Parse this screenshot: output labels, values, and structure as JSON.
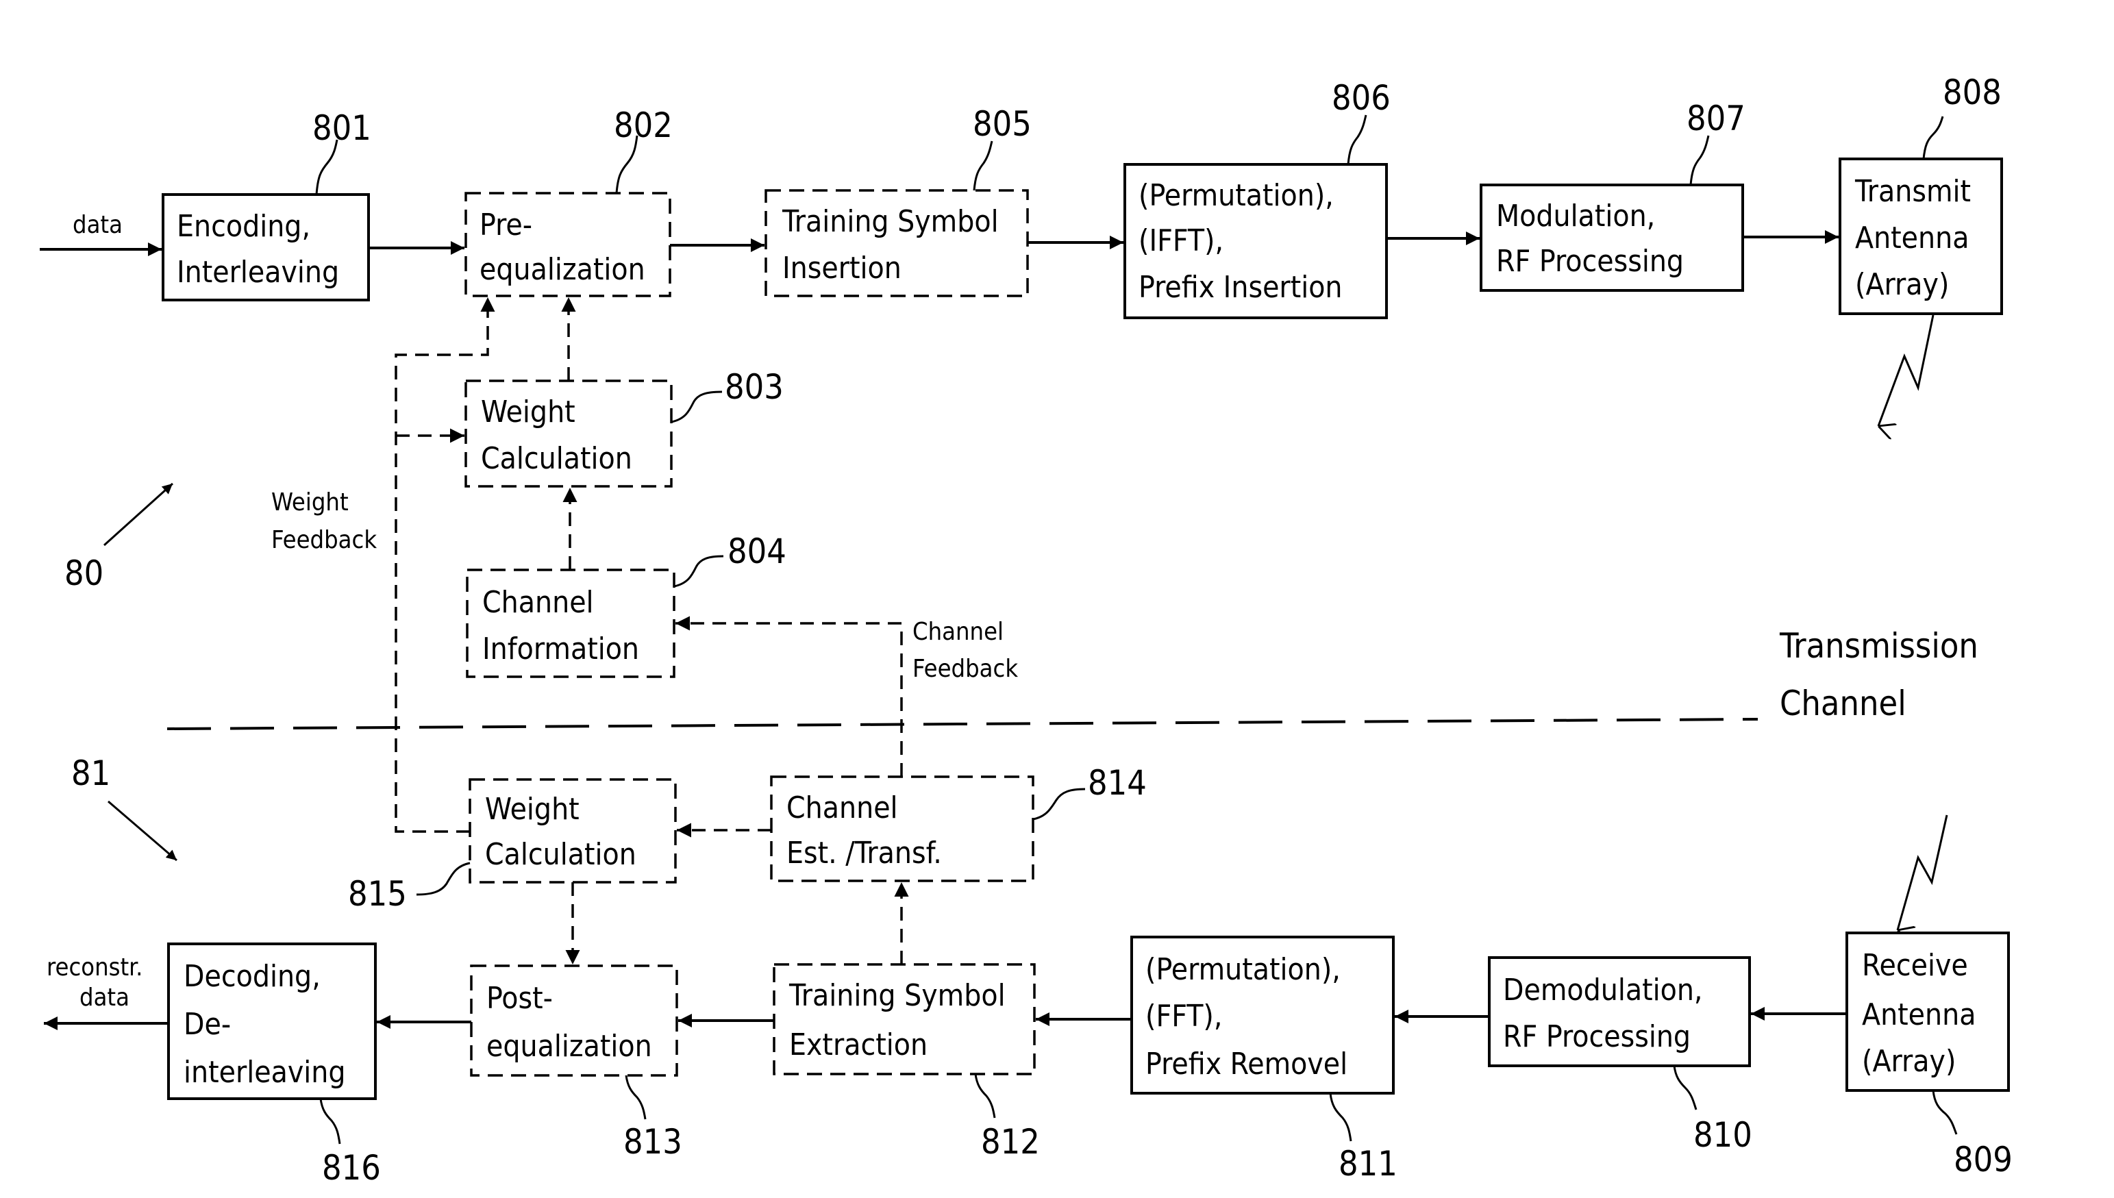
{
  "figure": {
    "transmitter_ref": "80",
    "receiver_ref": "81",
    "channel_label": [
      "Transmission",
      "Channel"
    ],
    "input_label": "data",
    "output_label": [
      "reconstr.",
      "data"
    ],
    "weight_feedback_label": [
      "Weight",
      "Feedback"
    ],
    "channel_feedback_label": [
      "Channel",
      "Feedback"
    ]
  },
  "transmitter_blocks": [
    {
      "ref": "801",
      "lines": [
        "Encoding,",
        "Interleaving"
      ],
      "style": "solid"
    },
    {
      "ref": "802",
      "lines": [
        "Pre-",
        "equalization"
      ],
      "style": "dashed"
    },
    {
      "ref": "805",
      "lines": [
        "Training Symbol",
        "Insertion"
      ],
      "style": "dashed"
    },
    {
      "ref": "806",
      "lines": [
        "(Permutation),",
        "(IFFT),",
        "Prefix Insertion"
      ],
      "style": "solid"
    },
    {
      "ref": "807",
      "lines": [
        "Modulation,",
        "RF Processing"
      ],
      "style": "solid"
    },
    {
      "ref": "808",
      "lines": [
        "Transmit",
        "Antenna",
        "(Array)"
      ],
      "style": "solid"
    },
    {
      "ref": "803",
      "lines": [
        "Weight",
        "Calculation"
      ],
      "style": "dashed"
    },
    {
      "ref": "804",
      "lines": [
        "Channel",
        "Information"
      ],
      "style": "dashed"
    }
  ],
  "receiver_blocks": [
    {
      "ref": "809",
      "lines": [
        "Receive",
        "Antenna",
        "(Array)"
      ],
      "style": "solid"
    },
    {
      "ref": "810",
      "lines": [
        "Demodulation,",
        "RF Processing"
      ],
      "style": "solid"
    },
    {
      "ref": "811",
      "lines": [
        "(Permutation),",
        "(FFT),",
        "Prefix Removel"
      ],
      "style": "solid"
    },
    {
      "ref": "812",
      "lines": [
        "Training Symbol",
        "Extraction"
      ],
      "style": "dashed"
    },
    {
      "ref": "813",
      "lines": [
        "Post-",
        "equalization"
      ],
      "style": "dashed"
    },
    {
      "ref": "814",
      "lines": [
        "Channel",
        "Est. /Transf."
      ],
      "style": "dashed"
    },
    {
      "ref": "815",
      "lines": [
        "Weight",
        "Calculation"
      ],
      "style": "dashed"
    },
    {
      "ref": "816",
      "lines": [
        "Decoding,",
        "De-",
        "interleaving"
      ],
      "style": "solid"
    }
  ]
}
